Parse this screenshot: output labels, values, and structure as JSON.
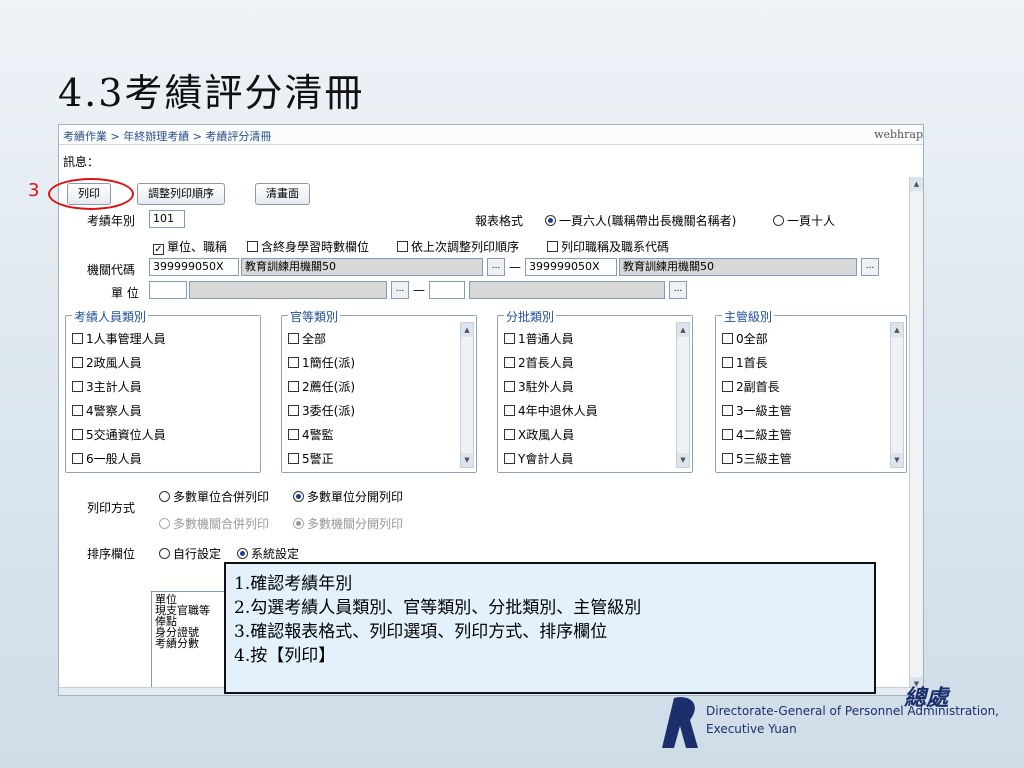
{
  "slide": {
    "title": "4.3考績評分清冊",
    "step_marker": "3"
  },
  "app": {
    "breadcrumb": "考績作業 > 年終辦理考績 > 考績評分清冊",
    "server_label": "webhrap",
    "message_label": "訊息：",
    "toolbar": {
      "print": "列印",
      "reorder": "調整列印順序",
      "clear": "清畫面"
    },
    "year": {
      "label": "考績年別",
      "value": "101"
    },
    "report_format": {
      "label": "報表格式",
      "option_six": "一頁六人(職稱帶出長機關名稱者)",
      "option_ten": "一頁十人",
      "selected": "option_six"
    },
    "print_options": {
      "unit_title": "單位、職稱",
      "lifelong": "含終身學習時數欄位",
      "last_order": "依上次調整列印順序",
      "title_code": "列印職稱及職系代碼"
    },
    "agency_code": {
      "label": "機關代碼",
      "from_code": "399999050X",
      "from_name": "教育訓練用機關50",
      "dash": "—",
      "to_code": "399999050X",
      "to_name": "教育訓練用機關50"
    },
    "unit": {
      "label": "單 位",
      "dash": "—"
    },
    "groups": {
      "personnel": {
        "title": "考績人員類別",
        "items": [
          "1人事管理人員",
          "2政風人員",
          "3主計人員",
          "4警察人員",
          "5交通資位人員",
          "6一般人員"
        ]
      },
      "rank": {
        "title": "官等類別",
        "items": [
          "全部",
          "1簡任(派)",
          "2薦任(派)",
          "3委任(派)",
          "4警監",
          "5警正"
        ]
      },
      "batch": {
        "title": "分批類別",
        "items": [
          "1普通人員",
          "2首長人員",
          "3駐外人員",
          "4年中退休人員",
          "X政風人員",
          "Y會計人員"
        ]
      },
      "supervisor": {
        "title": "主管級別",
        "items": [
          "0全部",
          "1首長",
          "2副首長",
          "3一級主管",
          "4二級主管",
          "5三級主管"
        ]
      }
    },
    "print_method": {
      "label": "列印方式",
      "unit_merge": "多數單位合併列印",
      "unit_split": "多數單位分開列印",
      "agency_merge": "多數機關合併列印",
      "agency_split": "多數機關分開列印"
    },
    "sort_field": {
      "label": "排序欄位",
      "custom": "自行設定",
      "system": "系統設定",
      "list": [
        "單位",
        "現支官職等",
        "俸點",
        "身分證號",
        "考績分數"
      ]
    }
  },
  "callout": {
    "lines": [
      "1.確認考績年別",
      "2.勾選考績人員類別、官等類別、分批類別、主管級別",
      "3.確認報表格式、列印選項、列印方式、排序欄位",
      "4.按【列印】"
    ]
  },
  "logo": {
    "cn": "總處",
    "en_line1": "Directorate-General of Personnel Administration,",
    "en_line2": "Executive Yuan"
  },
  "colors": {
    "accent": "#1f4f9c",
    "highlight": "#dd1111",
    "callout_bg": "#e2f1fb"
  }
}
